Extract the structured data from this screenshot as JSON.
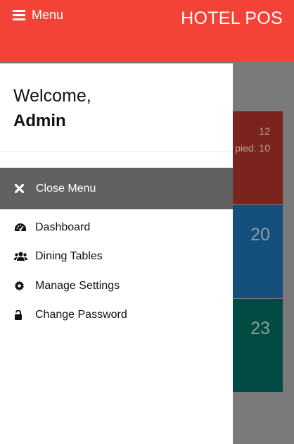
{
  "header": {
    "menu_label": "Menu",
    "app_title": "HOTEL POS",
    "accent_color": "#f44336"
  },
  "background_tiles": [
    {
      "line1": "12",
      "line2": "pied: 10",
      "color": "#7b231d"
    },
    {
      "value": "20",
      "color": "#154f7c"
    },
    {
      "value": "23",
      "color": "#024b43"
    }
  ],
  "drawer": {
    "greeting": "Welcome,",
    "user_name": "Admin",
    "close_label": "Close Menu",
    "items": [
      {
        "label": "Dashboard",
        "icon": "dashboard-icon"
      },
      {
        "label": "Dining Tables",
        "icon": "users-icon"
      },
      {
        "label": "Manage Settings",
        "icon": "gear-icon"
      },
      {
        "label": "Change Password",
        "icon": "unlock-icon"
      }
    ]
  }
}
